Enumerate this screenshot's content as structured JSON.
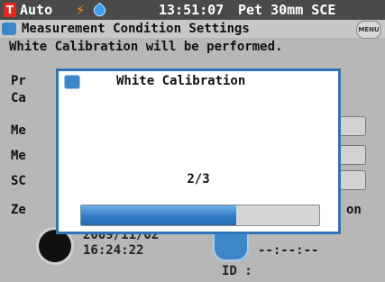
{
  "status_bar": {
    "mode": "Auto",
    "time": "13:51:07",
    "target": "Pet 30mm SCE",
    "icons": [
      "t-icon",
      "flash-icon",
      "drop-icon"
    ]
  },
  "header": {
    "title": "Measurement Condition Settings",
    "menu_label": "MENU"
  },
  "background": {
    "notice": "White Calibration will be performed.",
    "lines": [
      "Pr",
      "Ca",
      "Me",
      "Me",
      "SC",
      "Ze"
    ],
    "right_text": "on",
    "date": "2009/11/02",
    "time": "16:24:22",
    "blank_time": "--:--:--",
    "id_label": "ID :"
  },
  "dialog": {
    "title": "White Calibration",
    "progress_text": "2/3",
    "progress_fraction": 0.65
  },
  "colors": {
    "status_bg": "#4a4a4a",
    "dialog_border": "#2f73b8",
    "progress_fill": "#2f78c4",
    "accent_red": "#e0281e"
  }
}
